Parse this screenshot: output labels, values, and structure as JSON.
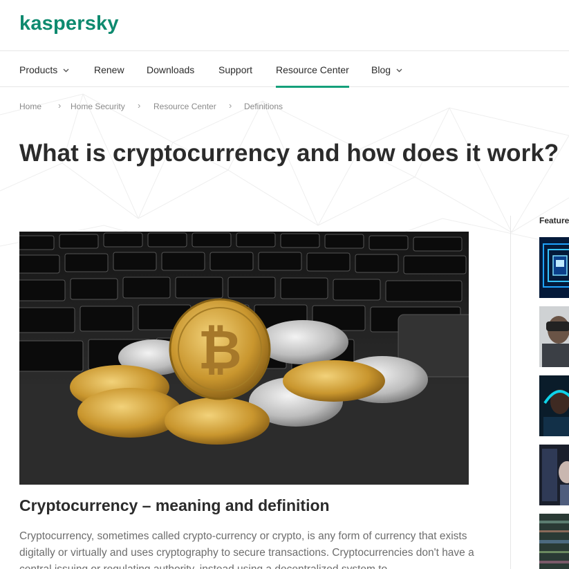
{
  "brand": {
    "logo_text": "kaspersky",
    "color": "#0e8a6f",
    "accent": "#14a07a"
  },
  "nav": {
    "items": [
      {
        "label": "Products",
        "has_dropdown": true
      },
      {
        "label": "Renew",
        "has_dropdown": false
      },
      {
        "label": "Downloads",
        "has_dropdown": false
      },
      {
        "label": "Support",
        "has_dropdown": false
      },
      {
        "label": "Resource Center",
        "has_dropdown": false,
        "active": true
      },
      {
        "label": "Blog",
        "has_dropdown": true
      }
    ],
    "dropdown_icon": "chevron-down-icon"
  },
  "breadcrumb": {
    "items": [
      "Home",
      "Home Security",
      "Resource Center",
      "Definitions"
    ],
    "separator": "›"
  },
  "article": {
    "title": "What is cryptocurrency and how does it work?",
    "hero_image": "bitcoin-coins-on-laptop-keyboard",
    "section_title": "Cryptocurrency – meaning and definition",
    "body": "Cryptocurrency, sometimes called crypto-currency or crypto, is any form of currency that exists digitally or virtually and uses cryptography to secure transactions. Cryptocurrencies don't have a central issuing or regulating authority, instead using a decentralized system to"
  },
  "sidebar": {
    "featured_label": "Featured",
    "thumbnails": [
      "cyber-lock-thumbnail",
      "vr-headset-thumbnail",
      "gamer-thumbnail",
      "mobile-user-thumbnail",
      "glitch-screen-thumbnail"
    ]
  }
}
